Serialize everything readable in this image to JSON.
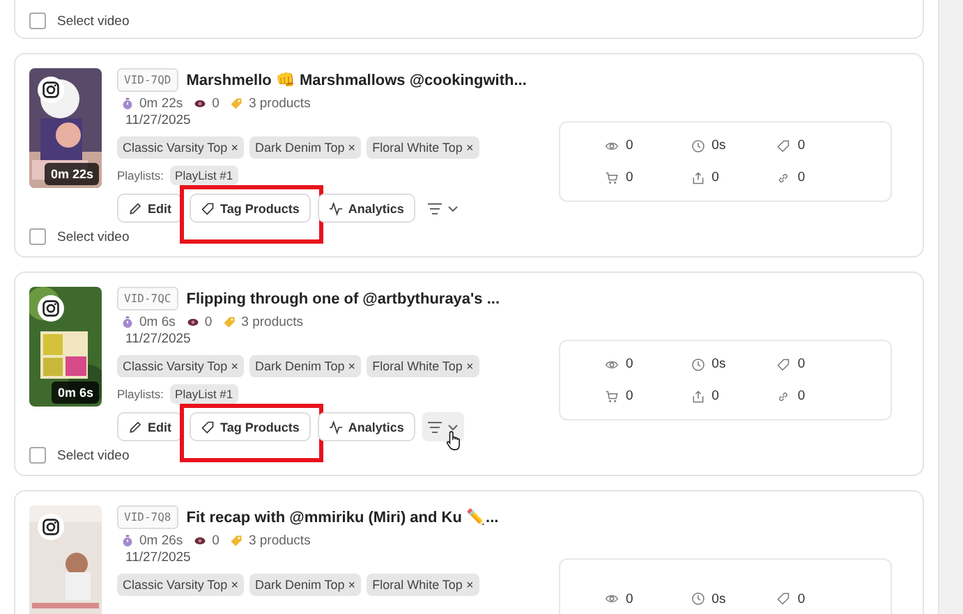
{
  "top_card": {
    "select_label": "Select video",
    "selected": false
  },
  "videos": [
    {
      "id": "VID-7QD",
      "title": "Marshmello 👊 Marshmallows @cookingwith...",
      "duration": "0m 22s",
      "views": "0",
      "products": "3 products",
      "date": "11/27/2025",
      "thumb_duration": "0m 22s",
      "tags": [
        {
          "label": "Classic Varsity Top",
          "remove": "×"
        },
        {
          "label": "Dark Denim Top",
          "remove": "×"
        },
        {
          "label": "Floral White Top",
          "remove": "×"
        }
      ],
      "playlists_label": "Playlists:",
      "playlists": [
        "PlayList #1"
      ],
      "actions": [
        {
          "kind": "edit",
          "label": "Edit",
          "highlighted": false,
          "hovered": false
        },
        {
          "kind": "tag",
          "label": "Tag Products",
          "highlighted": true,
          "hovered": false
        },
        {
          "kind": "analytics",
          "label": "Analytics",
          "highlighted": false,
          "hovered": false
        },
        {
          "kind": "filter",
          "highlighted": false,
          "hovered": false
        }
      ],
      "select_label": "Select video",
      "selected": false,
      "stats": [
        {
          "kind": "views",
          "value": "0"
        },
        {
          "kind": "time",
          "value": "0s"
        },
        {
          "kind": "tags",
          "value": "0"
        },
        {
          "kind": "cart",
          "value": "0"
        },
        {
          "kind": "shares",
          "value": "0"
        },
        {
          "kind": "links",
          "value": "0"
        }
      ]
    },
    {
      "id": "VID-7QC",
      "title": "Flipping through one of @artbythuraya's ...",
      "duration": "0m 6s",
      "views": "0",
      "products": "3 products",
      "date": "11/27/2025",
      "thumb_duration": "0m 6s",
      "tags": [
        {
          "label": "Classic Varsity Top",
          "remove": "×"
        },
        {
          "label": "Dark Denim Top",
          "remove": "×"
        },
        {
          "label": "Floral White Top",
          "remove": "×"
        }
      ],
      "playlists_label": "Playlists:",
      "playlists": [
        "PlayList #1"
      ],
      "actions": [
        {
          "kind": "edit",
          "label": "Edit",
          "highlighted": false,
          "hovered": false
        },
        {
          "kind": "tag",
          "label": "Tag Products",
          "highlighted": true,
          "hovered": false
        },
        {
          "kind": "analytics",
          "label": "Analytics",
          "highlighted": false,
          "hovered": false
        },
        {
          "kind": "filter",
          "highlighted": false,
          "hovered": true
        }
      ],
      "select_label": "Select video",
      "selected": false,
      "stats": [
        {
          "kind": "views",
          "value": "0"
        },
        {
          "kind": "time",
          "value": "0s"
        },
        {
          "kind": "tags",
          "value": "0"
        },
        {
          "kind": "cart",
          "value": "0"
        },
        {
          "kind": "shares",
          "value": "0"
        },
        {
          "kind": "links",
          "value": "0"
        }
      ]
    },
    {
      "id": "VID-7Q8",
      "title": "Fit recap with @mmiriku (Miri) and Ku ✏️...",
      "duration": "0m 26s",
      "views": "0",
      "products": "3 products",
      "date": "11/27/2025",
      "tags": [
        {
          "label": "Classic Varsity Top",
          "remove": "×"
        },
        {
          "label": "Dark Denim Top",
          "remove": "×"
        },
        {
          "label": "Floral White Top",
          "remove": "×"
        }
      ],
      "stats": [
        {
          "kind": "views",
          "value": "0"
        },
        {
          "kind": "time",
          "value": "0s"
        },
        {
          "kind": "tags",
          "value": "0"
        }
      ]
    }
  ]
}
